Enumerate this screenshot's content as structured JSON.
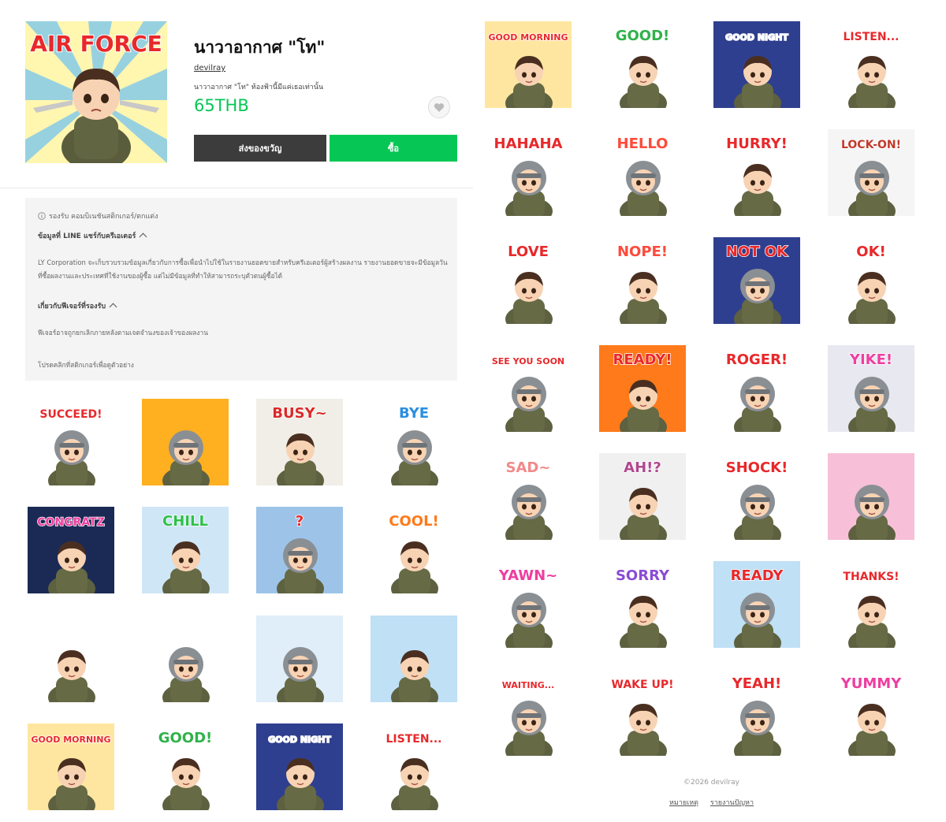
{
  "product": {
    "title": "นาวาอากาศ \"โท\"",
    "author": "devilray",
    "description": "นาวาอากาศ \"โท\" ท้องฟ้านี้มีแค่เธอเท่านั้น",
    "price": "65THB",
    "gift_label": "ส่งของขวัญ",
    "buy_label": "ซื้อ",
    "main_image_text": "AIR FORCE",
    "colors": {
      "price": "#06c755",
      "buy": "#06c755",
      "gift": "#3c3c3c"
    }
  },
  "info": {
    "support": "รองรับ คอมบิเนชันสติกเกอร์/ตกแต่ง",
    "data_heading": "ข้อมูลที่ LINE แชร์กับครีเอเตอร์",
    "data_text": "LY Corporation จะเก็บรวบรวมข้อมูลเกี่ยวกับการซื้อเพื่อนำไปใช้ในรายงานยอดขายสำหรับครีเอเตอร์ผู้สร้างผลงาน รายงานยอดขายจะมีข้อมูลวันที่ซื้อผลงานและประเทศที่ใช้งานของผู้ซื้อ แต่ไม่มีข้อมูลที่ทำให้สามารถระบุตัวตนผู้ซื้อได้",
    "features_heading": "เกี่ยวกับฟีเจอร์ที่รองรับ",
    "features_text": "ฟีเจอร์อาจถูกยกเลิกภายหลังตามเจตจำนงของเจ้าของผลงาน",
    "preview_hint": "โปรดคลิกที่สติกเกอร์เพื่อดูตัวอย่าง"
  },
  "left_stickers": [
    {
      "text": "SUCCEED!",
      "color": "#e8282b",
      "bg": "#ffffff",
      "helmet": true
    },
    {
      "text": "",
      "color": "#e8282b",
      "bg": "#ffb020",
      "helmet": true
    },
    {
      "text": "BUSY~",
      "color": "#d92a2a",
      "bg": "#f0eee6",
      "helmet": false
    },
    {
      "text": "BYE",
      "color": "#2a8fe0",
      "bg": "#ffffff",
      "helmet": true
    },
    {
      "text": "CONGRATZ",
      "color": "#ee3ea0",
      "bg": "#1b2a55",
      "helmet": false
    },
    {
      "text": "CHILL",
      "color": "#2fbf4a",
      "bg": "#cfe6f7",
      "helmet": false
    },
    {
      "text": "?",
      "color": "#e8282b",
      "bg": "#9dc4e8",
      "helmet": true
    },
    {
      "text": "COOL!",
      "color": "#ff7a1a",
      "bg": "#ffffff",
      "helmet": false
    },
    {
      "text": "",
      "color": "#999999",
      "bg": "#ffffff",
      "helmet": false
    },
    {
      "text": "",
      "color": "#f0c020",
      "bg": "#ffffff",
      "helmet": true
    },
    {
      "text": "",
      "color": "#e8282b",
      "bg": "#dfeef9",
      "helmet": true
    },
    {
      "text": "",
      "color": "#e8282b",
      "bg": "#bfe0f5",
      "helmet": false
    },
    {
      "text": "GOOD MORNING",
      "color": "#e8282b",
      "bg": "#ffe6a0",
      "helmet": false
    },
    {
      "text": "GOOD!",
      "color": "#2fb24a",
      "bg": "#ffffff",
      "helmet": false
    },
    {
      "text": "GOOD NIGHT",
      "color": "#ffffff",
      "bg": "#2f3f8f",
      "helmet": false
    },
    {
      "text": "LISTEN...",
      "color": "#e8282b",
      "bg": "#ffffff",
      "helmet": false
    }
  ],
  "right_stickers": [
    {
      "text": "GOOD MORNING",
      "color": "#e8282b",
      "bg": "#ffe6a0",
      "helmet": false
    },
    {
      "text": "GOOD!",
      "color": "#2fb24a",
      "bg": "#ffffff",
      "helmet": false
    },
    {
      "text": "GOOD NIGHT",
      "color": "#ffffff",
      "bg": "#2f3f8f",
      "helmet": false
    },
    {
      "text": "LISTEN...",
      "color": "#e8282b",
      "bg": "#ffffff",
      "helmet": false
    },
    {
      "text": "HAHAHA",
      "color": "#e8282b",
      "bg": "#ffffff",
      "helmet": true
    },
    {
      "text": "HELLO",
      "color": "#ff4a3a",
      "bg": "#ffffff",
      "helmet": true
    },
    {
      "text": "HURRY!",
      "color": "#e8282b",
      "bg": "#ffffff",
      "helmet": false
    },
    {
      "text": "LOCK-ON!",
      "color": "#c0392b",
      "bg": "#f5f5f5",
      "helmet": true
    },
    {
      "text": "LOVE",
      "color": "#e8282b",
      "bg": "#ffffff",
      "helmet": false
    },
    {
      "text": "NOPE!",
      "color": "#ff4a3a",
      "bg": "#ffffff",
      "helmet": false
    },
    {
      "text": "NOT OK",
      "color": "#e8282b",
      "bg": "#2f3f8f",
      "helmet": true
    },
    {
      "text": "OK!",
      "color": "#e8282b",
      "bg": "#ffffff",
      "helmet": false
    },
    {
      "text": "SEE YOU SOON",
      "color": "#e8282b",
      "bg": "#ffffff",
      "helmet": true
    },
    {
      "text": "READY!",
      "color": "#e8282b",
      "bg": "#ff7a1a",
      "helmet": false
    },
    {
      "text": "ROGER!",
      "color": "#e8282b",
      "bg": "#ffffff",
      "helmet": true
    },
    {
      "text": "YIKE!",
      "color": "#ee3ea0",
      "bg": "#e8e8f0",
      "helmet": true
    },
    {
      "text": "SAD~",
      "color": "#f08a8a",
      "bg": "#ffffff",
      "helmet": true
    },
    {
      "text": "AH!?",
      "color": "#b0488f",
      "bg": "#f0f0f0",
      "helmet": false
    },
    {
      "text": "SHOCK!",
      "color": "#e8282b",
      "bg": "#ffffff",
      "helmet": true
    },
    {
      "text": "",
      "color": "#e8282b",
      "bg": "#f7c0d8",
      "helmet": true
    },
    {
      "text": "YAWN~",
      "color": "#ee3ea0",
      "bg": "#ffffff",
      "helmet": true
    },
    {
      "text": "SORRY",
      "color": "#8a4bd6",
      "bg": "#ffffff",
      "helmet": false
    },
    {
      "text": "READY",
      "color": "#e8282b",
      "bg": "#bfe0f5",
      "helmet": true
    },
    {
      "text": "THANKS!",
      "color": "#e8282b",
      "bg": "#ffffff",
      "helmet": false
    },
    {
      "text": "WAITING...",
      "color": "#e8282b",
      "bg": "#ffffff",
      "helmet": true
    },
    {
      "text": "WAKE UP!",
      "color": "#e8282b",
      "bg": "#ffffff",
      "helmet": false
    },
    {
      "text": "YEAH!",
      "color": "#e8282b",
      "bg": "#ffffff",
      "helmet": true
    },
    {
      "text": "YUMMY",
      "color": "#ee3ea0",
      "bg": "#ffffff",
      "helmet": false
    }
  ],
  "footer": {
    "copyright": "©2026 devilray",
    "notes_link": "หมายเหตุ",
    "report_link": "รายงานปัญหา"
  }
}
